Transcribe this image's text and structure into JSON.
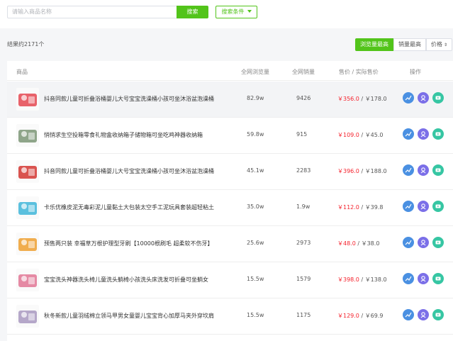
{
  "search": {
    "placeholder": "请输入商品名称",
    "button": "搜索",
    "conditions": "搜索条件"
  },
  "summary": {
    "result_count": "结果约2171个"
  },
  "sort": {
    "options": [
      "浏览量最高",
      "销量最高",
      "价格"
    ],
    "active": "浏览量最高"
  },
  "table": {
    "headers": {
      "product": "商品",
      "views": "全网浏览量",
      "sales": "全网销量",
      "price": "售价 / 实际售价",
      "actions": "操作"
    },
    "rows": [
      {
        "title": "抖音同款儿童可折叠浴桶婴儿大号宝宝洗澡桶小孩可坐沐浴盆泡澡桶",
        "views": "82.9w",
        "sales": "9426",
        "sale_price": "￥356.0",
        "actual_price": "￥178.0",
        "thumb_color": "#e8626a"
      },
      {
        "title": "悄悄求生空投箱零食礼物盒收纳箱子储物箱可坐吃鸡神器收纳箱",
        "views": "59.8w",
        "sales": "915",
        "sale_price": "￥109.0",
        "actual_price": "￥45.0",
        "thumb_color": "#8fa58a"
      },
      {
        "title": "抖音同款儿童可折叠浴桶婴儿大号宝宝洗澡桶小孩可坐沐浴盆泡澡桶",
        "views": "45.1w",
        "sales": "2283",
        "sale_price": "￥396.0",
        "actual_price": "￥188.0",
        "thumb_color": "#d9534f"
      },
      {
        "title": "卡乐优橡皮泥无毒彩泥儿童黏土大包装太空手工泥玩具套装超轻粘土",
        "views": "35.0w",
        "sales": "1.9w",
        "sale_price": "￥112.0",
        "actual_price": "￥39.8",
        "thumb_color": "#5bc0de"
      },
      {
        "title": "预售两只装 幸福草万根护理型牙刷【10000根刷毛 超柔软不伤牙】",
        "views": "25.6w",
        "sales": "2973",
        "sale_price": "￥48.0",
        "actual_price": "￥38.0",
        "thumb_color": "#f0ad4e"
      },
      {
        "title": "宝宝洗头神器洗头椅儿童洗头躺椅小孩洗头床洗发可折叠可坐躺女",
        "views": "15.5w",
        "sales": "1579",
        "sale_price": "￥398.0",
        "actual_price": "￥138.0",
        "thumb_color": "#e58aa4"
      },
      {
        "title": "秋冬新款儿童羽绒棉立领马甲男女童婴儿宝宝背心加厚马夹外穿坎肩",
        "views": "15.5w",
        "sales": "1175",
        "sale_price": "￥129.0",
        "actual_price": "￥69.9",
        "thumb_color": "#b5a7c9"
      }
    ]
  },
  "icons": {
    "trend": "trend-chart-icon",
    "profile": "person-badge-icon",
    "video": "play-icon"
  },
  "colors": {
    "accent": "#52c41a",
    "price": "#f5222d",
    "op_blue": "#4a90e2",
    "op_purple": "#7b6fe8",
    "op_teal": "#36c6a3"
  }
}
